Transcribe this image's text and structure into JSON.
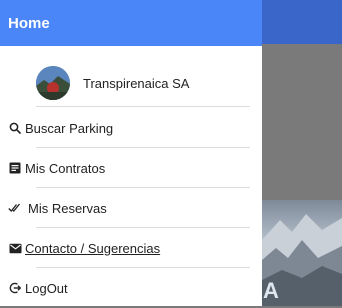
{
  "drawer": {
    "title": "Home",
    "profile": {
      "name": "Transpirenaica SA"
    },
    "items": [
      {
        "label": "Buscar Parking",
        "icon": "search-icon"
      },
      {
        "label": "Mis Contratos",
        "icon": "document-icon"
      },
      {
        "label": "Mis Reservas",
        "icon": "double-check-icon"
      },
      {
        "label": "Contacto / Sugerencias",
        "icon": "mail-icon"
      },
      {
        "label": "LogOut",
        "icon": "logout-icon"
      }
    ]
  },
  "background": {
    "photo_text": "A"
  },
  "colors": {
    "drawer_header": "#4a86f7",
    "app_header": "#3a66c9",
    "overlay": "#7a7a7a"
  }
}
